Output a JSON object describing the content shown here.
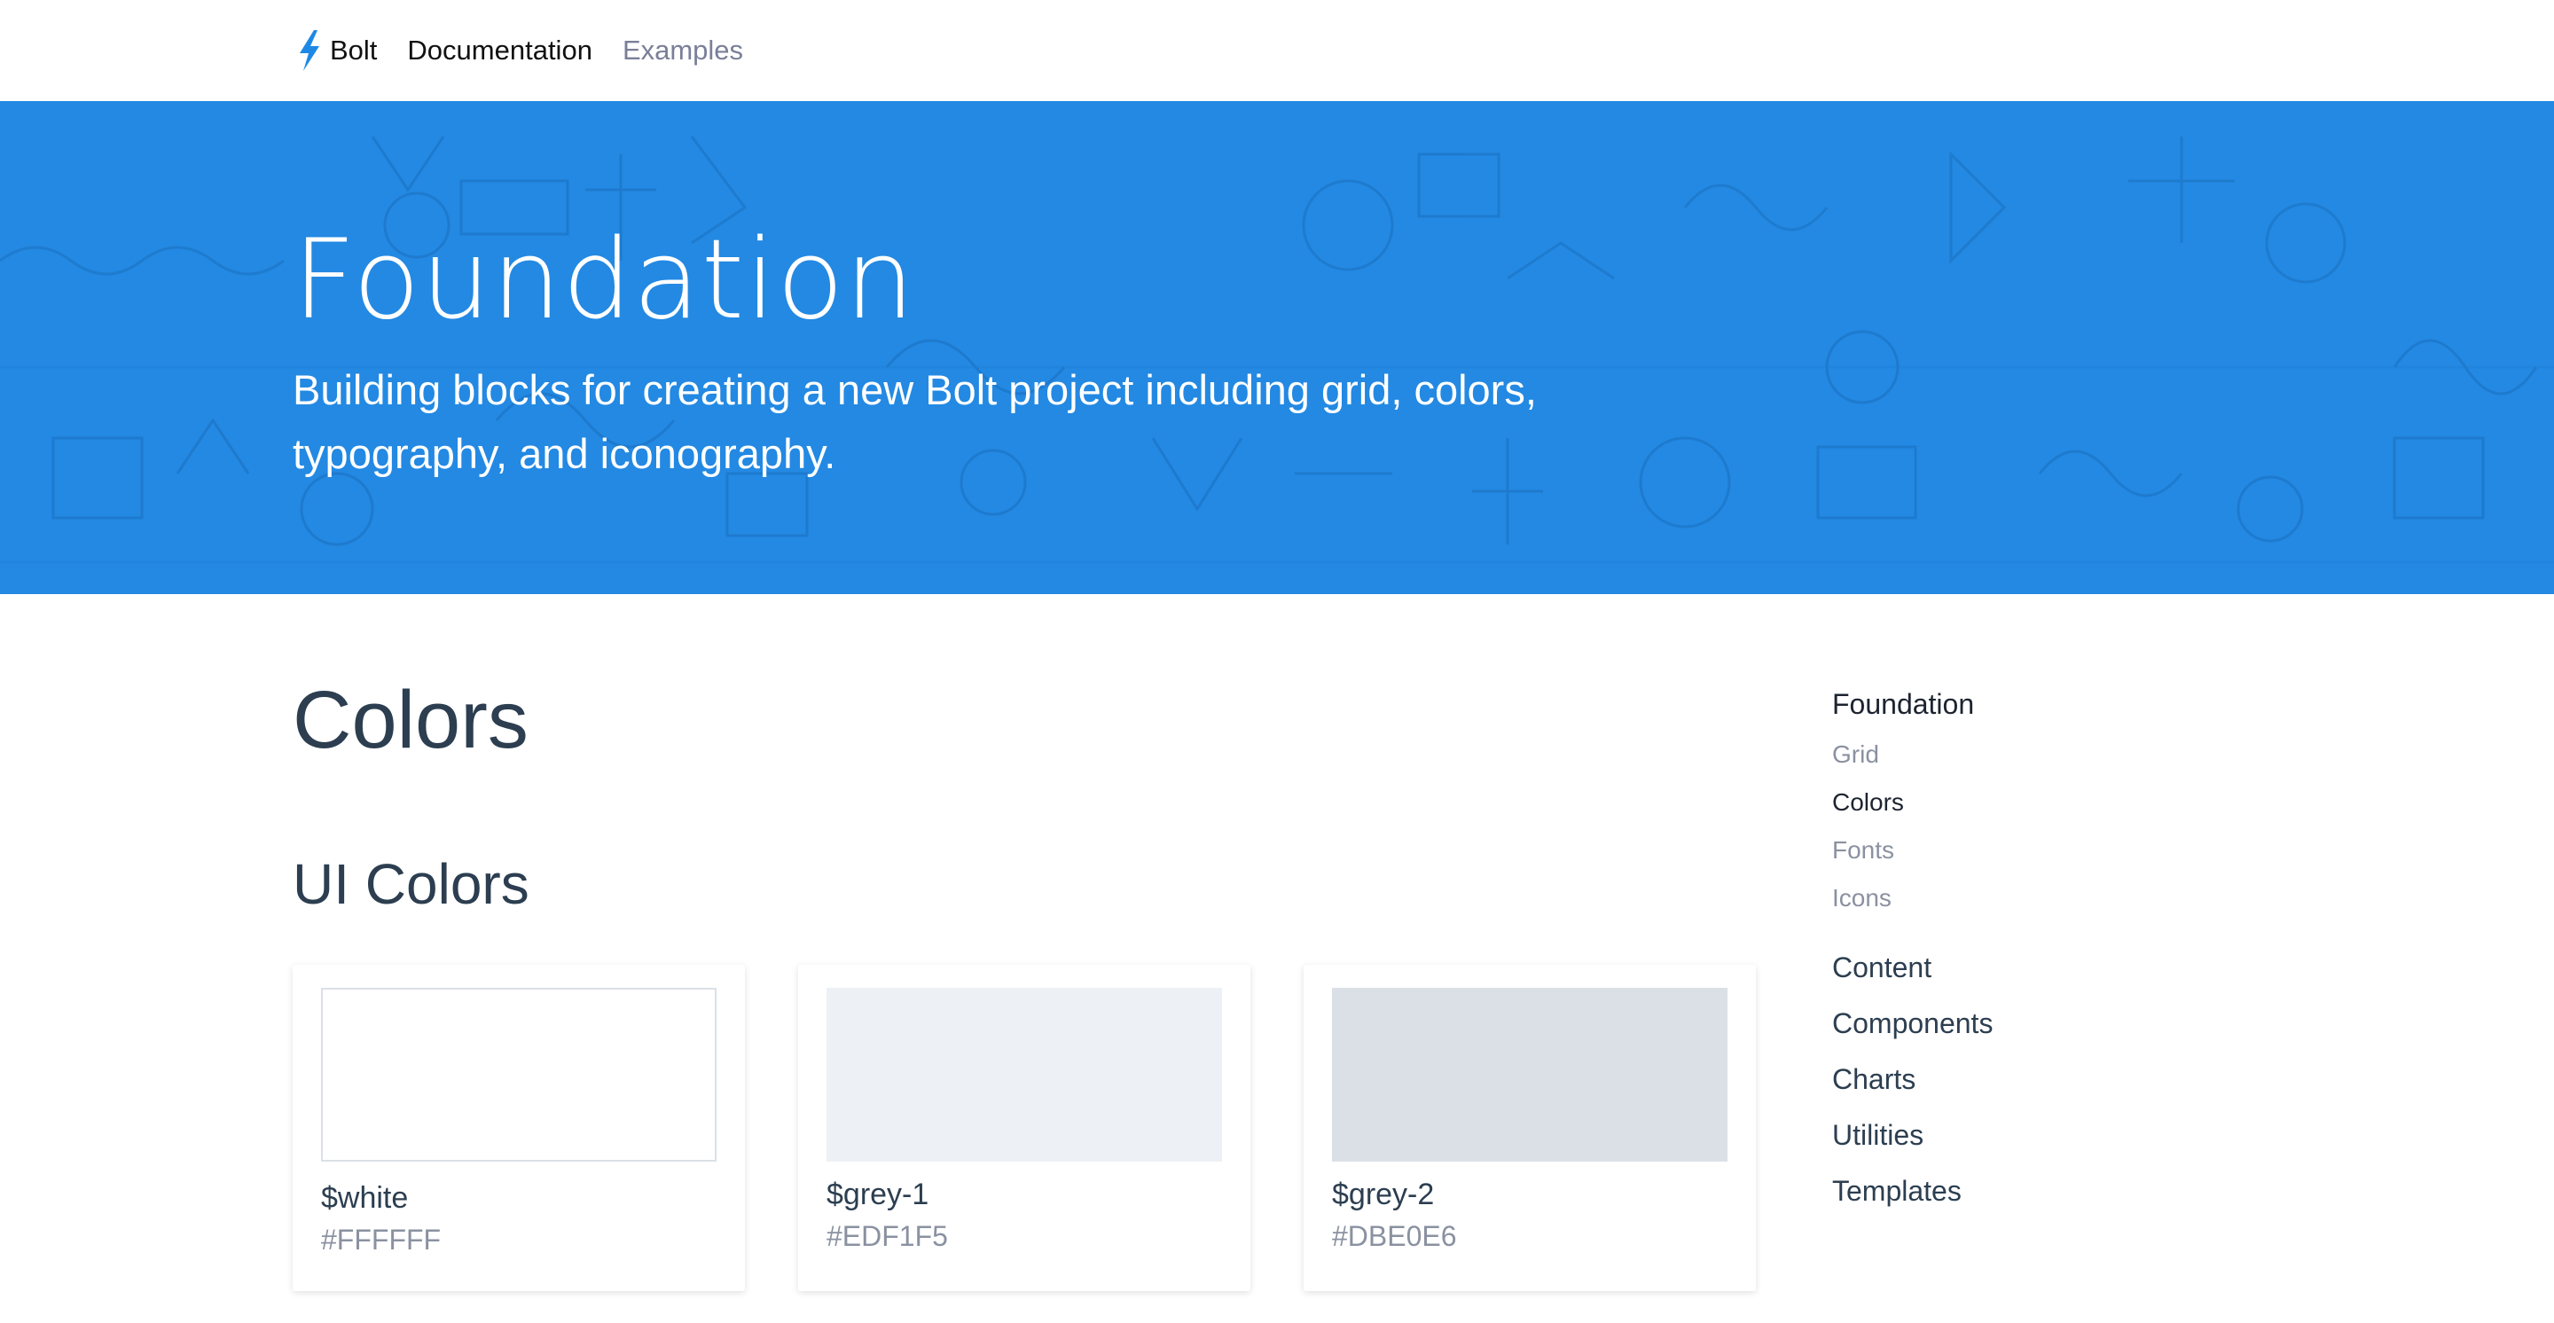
{
  "nav": {
    "brand": "Bolt",
    "links": [
      "Documentation",
      "Examples"
    ]
  },
  "hero": {
    "title": "Foundation",
    "subtitle": "Building blocks for creating a new Bolt project including grid, colors, typography, and iconography."
  },
  "main": {
    "page_title": "Colors",
    "section_title": "UI Colors",
    "colors": [
      {
        "name": "$white",
        "hex": "#FFFFFF"
      },
      {
        "name": "$grey-1",
        "hex": "#EDF1F5"
      },
      {
        "name": "$grey-2",
        "hex": "#DBE0E6"
      }
    ]
  },
  "sidebar": {
    "heading": "Foundation",
    "subitems": [
      "Grid",
      "Colors",
      "Fonts",
      "Icons"
    ],
    "current": "Colors",
    "sections": [
      "Content",
      "Components",
      "Charts",
      "Utilities",
      "Templates"
    ]
  },
  "colors": {
    "hero_bg": "#2389E3",
    "brand_bolt": "#1E88E5"
  }
}
